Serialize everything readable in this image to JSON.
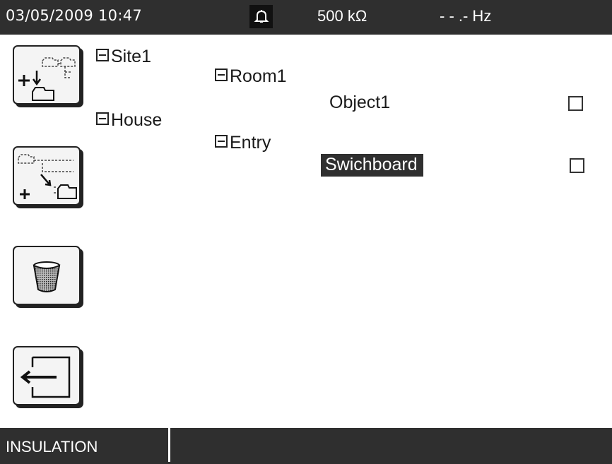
{
  "status_bar": {
    "datetime": "03/05/2009 10:47",
    "alarm_icon": "bell-icon",
    "resistance": "500  kΩ",
    "frequency": "- - .-  Hz"
  },
  "toolbar": {
    "add_site_icon": "add-site-icon",
    "add_subfolder_icon": "add-subfolder-icon",
    "delete_icon": "trash-icon",
    "exit_icon": "exit-icon"
  },
  "tree": {
    "site": "Site1",
    "house": "House",
    "room": "Room1",
    "entry": "Entry"
  },
  "objects": [
    {
      "label": "Object1",
      "checked": false,
      "selected": false
    },
    {
      "label": "Swichboard",
      "checked": false,
      "selected": true
    }
  ],
  "footer": {
    "mode": "INSULATION"
  },
  "colors": {
    "bar_background": "#2f2f2f",
    "screen_background": "#ffffff"
  }
}
